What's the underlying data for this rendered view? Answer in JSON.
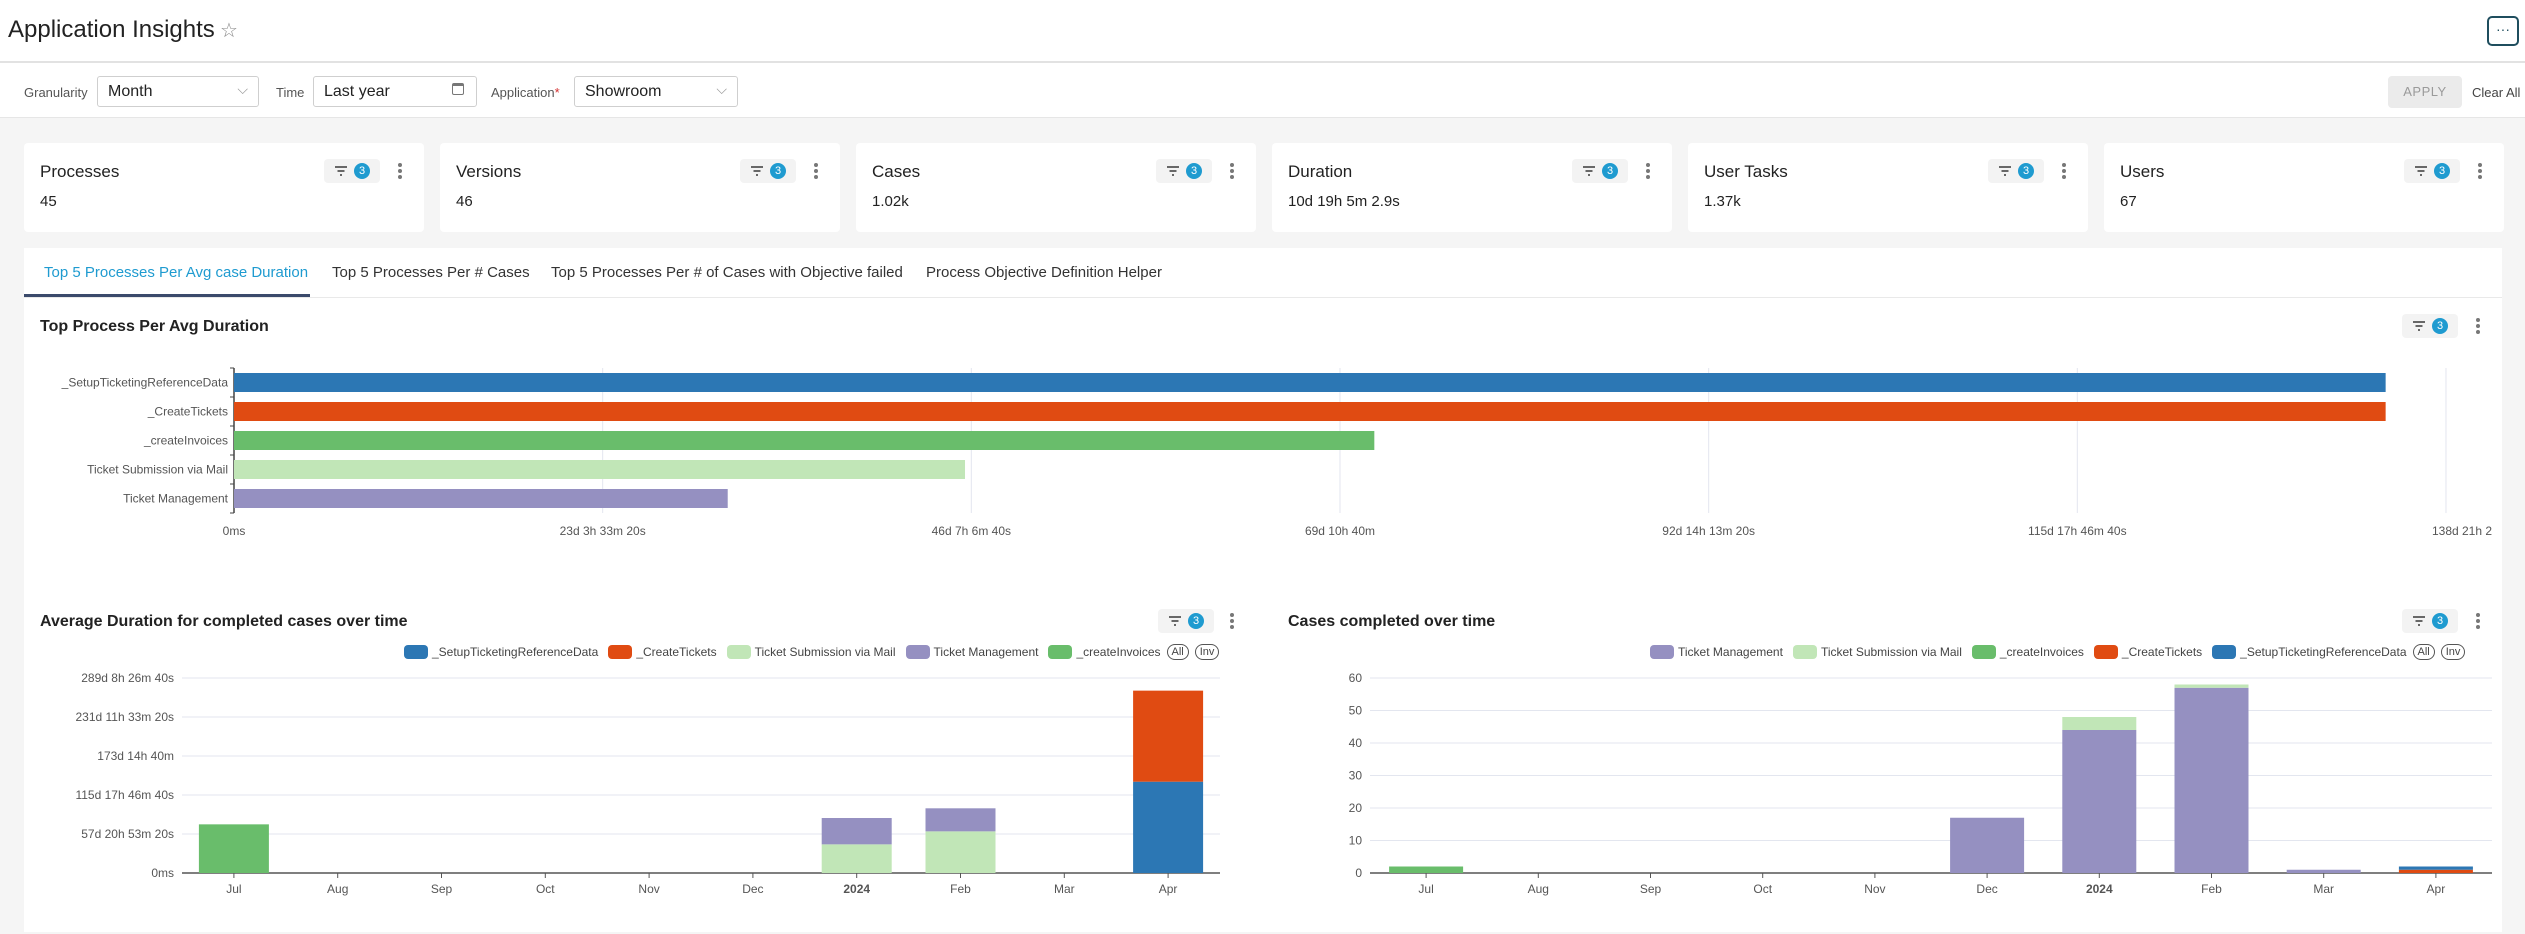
{
  "header": {
    "title": "Application Insights",
    "more_label": "···"
  },
  "filters": {
    "granularity_label": "Granularity",
    "granularity_value": "Month",
    "time_label": "Time",
    "time_value": "Last year",
    "application_label": "Application",
    "application_required": "*",
    "application_value": "Showroom",
    "apply_label": "APPLY",
    "clear_label": "Clear All"
  },
  "filter_count": "3",
  "cards": [
    {
      "title": "Processes",
      "value": "45"
    },
    {
      "title": "Versions",
      "value": "46"
    },
    {
      "title": "Cases",
      "value": "1.02k"
    },
    {
      "title": "Duration",
      "value": "10d 19h 5m 2.9s"
    },
    {
      "title": "User Tasks",
      "value": "1.37k"
    },
    {
      "title": "Users",
      "value": "67"
    }
  ],
  "tabs": [
    {
      "label": "Top 5 Processes Per Avg case Duration",
      "active": true
    },
    {
      "label": "Top 5 Processes Per # Cases",
      "active": false
    },
    {
      "label": "Top 5 Processes Per # of Cases with Objective failed",
      "active": false
    },
    {
      "label": "Process Objective Definition Helper",
      "active": false
    }
  ],
  "colors": {
    "setup": "#2c77b4",
    "create_tickets": "#e04b12",
    "create_invoices": "#69bd6b",
    "ticket_submission": "#c1e6b7",
    "ticket_management": "#9590c1",
    "accent": "#1f9bd0"
  },
  "chart_data": [
    {
      "type": "bar",
      "orientation": "horizontal",
      "title": "Top Process Per Avg Duration",
      "categories": [
        "_SetupTicketingReferenceData",
        "_CreateTickets",
        "_createInvoices",
        "Ticket Submission via Mail",
        "Ticket Management"
      ],
      "values_days": [
        135.1,
        135.1,
        71.6,
        45.9,
        31.0
      ],
      "colors": [
        "#2c77b4",
        "#e04b12",
        "#69bd6b",
        "#c1e6b7",
        "#9590c1"
      ],
      "xlim_days": [
        0,
        138.89
      ],
      "xticks_days": [
        0,
        23.148,
        46.296,
        69.444,
        92.593,
        115.741,
        138.889
      ],
      "xtick_labels": [
        "0ms",
        "23d 3h 33m 20s",
        "46d 7h 6m 40s",
        "69d 10h 40m",
        "92d 14h 13m 20s",
        "115d 17h 46m 40s",
        "138d 21h 2"
      ],
      "grid": true
    },
    {
      "type": "bar",
      "stacked": true,
      "title": "Average Duration for completed cases over time",
      "categories": [
        "Jul",
        "Aug",
        "Sep",
        "Oct",
        "Nov",
        "Dec",
        "2024",
        "Feb",
        "Mar",
        "Apr"
      ],
      "series": [
        {
          "name": "_SetupTicketingReferenceData",
          "color": "#2c77b4",
          "values": [
            0,
            0,
            0,
            0,
            0,
            0,
            0,
            0,
            0,
            135.5
          ]
        },
        {
          "name": "_CreateTickets",
          "color": "#e04b12",
          "values": [
            0,
            0,
            0,
            0,
            0,
            0,
            0,
            0,
            0,
            135.1
          ]
        },
        {
          "name": "Ticket Submission via Mail",
          "color": "#c1e6b7",
          "values": [
            0,
            0,
            0,
            0,
            0,
            0,
            42.5,
            61.8,
            0,
            0
          ]
        },
        {
          "name": "Ticket Management",
          "color": "#9590c1",
          "values": [
            0,
            0,
            0,
            0,
            0,
            0,
            39.1,
            34.2,
            0,
            0
          ]
        },
        {
          "name": "_createInvoices",
          "color": "#69bd6b",
          "values": [
            72.2,
            0,
            0,
            0,
            0,
            0,
            0,
            0,
            0,
            0
          ]
        }
      ],
      "stack_order": [
        "_SetupTicketingReferenceData",
        "_CreateTickets",
        "_createInvoices",
        "Ticket Submission via Mail",
        "Ticket Management"
      ],
      "unit": "days",
      "ylim_days": [
        0,
        289.35
      ],
      "yticks_days": [
        0,
        57.87,
        115.74,
        173.61,
        231.48,
        289.35
      ],
      "ytick_labels": [
        "0ms",
        "57d 20h 53m 20s",
        "115d 17h 46m 40s",
        "173d 14h 40m",
        "231d 11h 33m 20s",
        "289d 8h 26m 40s"
      ],
      "legend_extra": [
        "All",
        "Inv"
      ],
      "legend": "top-right",
      "grid": true
    },
    {
      "type": "bar",
      "stacked": true,
      "title": "Cases completed over time",
      "categories": [
        "Jul",
        "Aug",
        "Sep",
        "Oct",
        "Nov",
        "Dec",
        "2024",
        "Feb",
        "Mar",
        "Apr"
      ],
      "series": [
        {
          "name": "Ticket Management",
          "color": "#9590c1",
          "values": [
            0,
            0,
            0,
            0,
            0,
            17,
            44,
            57,
            1,
            0
          ]
        },
        {
          "name": "Ticket Submission via Mail",
          "color": "#c1e6b7",
          "values": [
            0,
            0,
            0,
            0,
            0,
            0,
            4,
            1,
            0,
            0
          ]
        },
        {
          "name": "_createInvoices",
          "color": "#69bd6b",
          "values": [
            2,
            0,
            0,
            0,
            0,
            0,
            0,
            0,
            0,
            0
          ]
        },
        {
          "name": "_CreateTickets",
          "color": "#e04b12",
          "values": [
            0,
            0,
            0,
            0,
            0,
            0,
            0,
            0,
            0,
            1
          ]
        },
        {
          "name": "_SetupTicketingReferenceData",
          "color": "#2c77b4",
          "values": [
            0,
            0,
            0,
            0,
            0,
            0,
            0,
            0,
            0,
            1
          ]
        }
      ],
      "stack_order": [
        "_CreateTickets",
        "_SetupTicketingReferenceData",
        "_createInvoices",
        "Ticket Management",
        "Ticket Submission via Mail"
      ],
      "ylim": [
        0,
        60
      ],
      "yticks": [
        0,
        10,
        20,
        30,
        40,
        50,
        60
      ],
      "legend_extra": [
        "All",
        "Inv"
      ],
      "legend": "top-right",
      "grid": true
    }
  ]
}
